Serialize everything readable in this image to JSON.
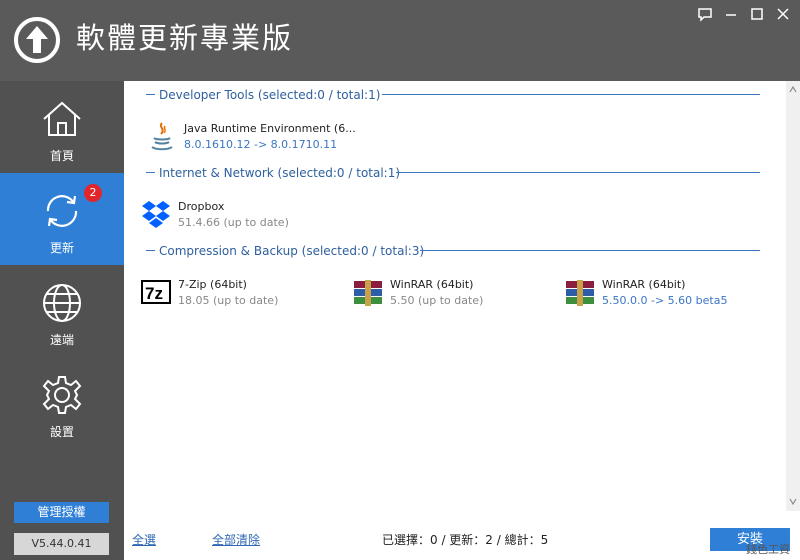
{
  "app": {
    "title": "軟體更新專業版"
  },
  "sidebar": {
    "items": [
      {
        "label": "首頁"
      },
      {
        "label": "更新",
        "badge": "2"
      },
      {
        "label": "遠端"
      },
      {
        "label": "設置"
      }
    ],
    "manage_label": "管理授權",
    "version": "V5.44.0.41"
  },
  "sections": [
    {
      "title": "Developer Tools (selected:0 / total:1)",
      "apps": [
        {
          "name": "Java Runtime Environment (6...",
          "version": "8.0.1610.12 -> 8.0.1710.11",
          "icon": "java-icon"
        }
      ]
    },
    {
      "title": "Internet & Network (selected:0 / total:1)",
      "apps": [
        {
          "name": "Dropbox",
          "version": "51.4.66 (up to date)",
          "icon": "dropbox-icon"
        }
      ]
    },
    {
      "title": "Compression & Backup (selected:0 / total:3)",
      "apps": [
        {
          "name": "7-Zip (64bit)",
          "version": "18.05 (up to date)",
          "icon": "7zip-icon"
        },
        {
          "name": "WinRAR (64bit)",
          "version": "5.50 (up to date)",
          "icon": "winrar-icon"
        },
        {
          "name": "WinRAR (64bit)",
          "version": "5.50.0.0 -> 5.60 beta5",
          "icon": "winrar-icon"
        }
      ]
    }
  ],
  "footer": {
    "select_all": "全選",
    "clear_all": "全部清除",
    "status": "已選擇：0 / 更新：2 / 總計：5",
    "install": "安裝"
  },
  "watermark": "錢色工資",
  "colors": {
    "accent": "#2f7fd6",
    "sidebar": "#515151",
    "titlebar": "#5a5a5a",
    "link": "#3a76c4"
  }
}
